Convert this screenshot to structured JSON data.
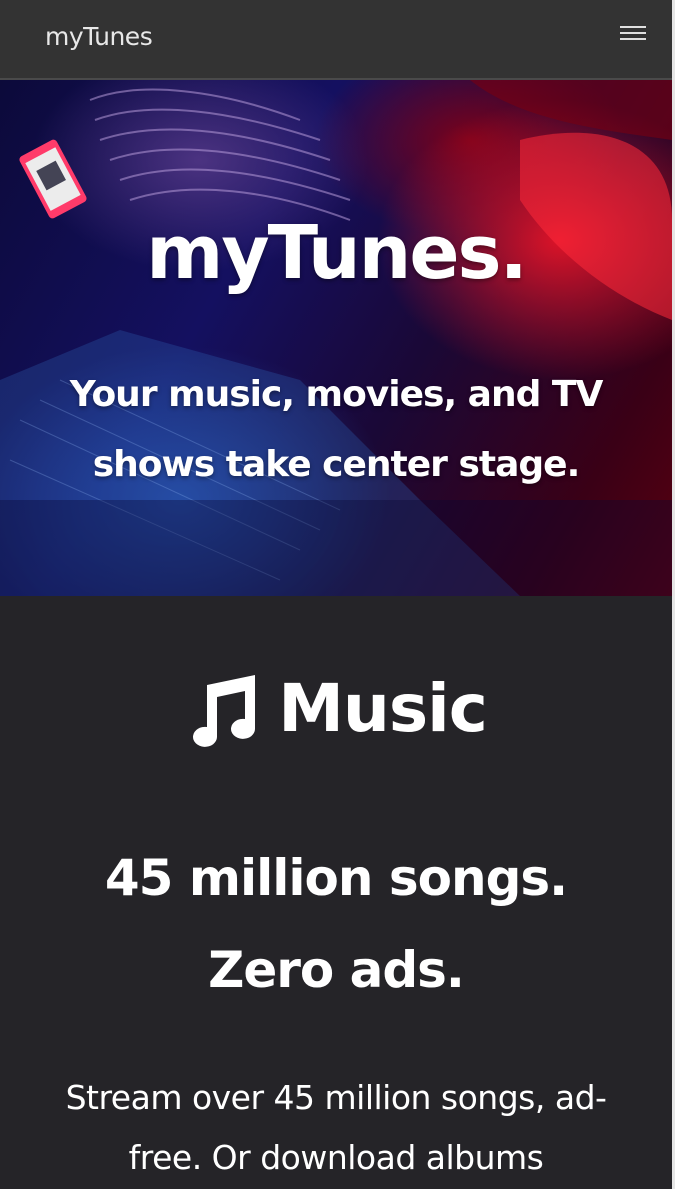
{
  "navbar": {
    "brand": "myTunes",
    "menu_icon": "hamburger-menu-icon"
  },
  "hero": {
    "title": "myTunes.",
    "subtitle": "Your music, movies, and TV shows take center stage."
  },
  "music_section": {
    "icon": "music-note-icon",
    "heading": "Music",
    "tagline_line1": "45 million songs.",
    "tagline_line2": "Zero ads.",
    "body": "Stream over 45 million songs, ad-free. Or download albums"
  },
  "colors": {
    "navbar_bg": "#333333",
    "page_bg": "#252428",
    "text": "#ffffff"
  }
}
